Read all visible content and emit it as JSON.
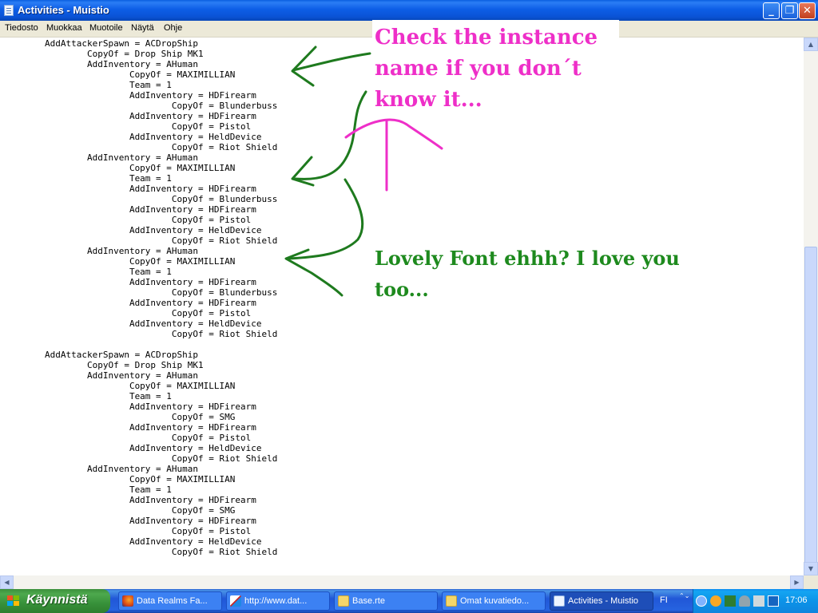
{
  "window": {
    "title": "Activities - Muistio",
    "min_glyph": "_",
    "max_glyph": "❐",
    "close_glyph": "✕"
  },
  "menu": [
    "Tiedosto",
    "Muokkaa",
    "Muotoile",
    "Näytä",
    "Ohje"
  ],
  "editor": {
    "lines": [
      "        AddAttackerSpawn = ACDropShip",
      "                CopyOf = Drop Ship MK1",
      "                AddInventory = AHuman",
      "                        CopyOf = MAXIMILLIAN",
      "                        Team = 1",
      "                        AddInventory = HDFirearm",
      "                                CopyOf = Blunderbuss",
      "                        AddInventory = HDFirearm",
      "                                CopyOf = Pistol",
      "                        AddInventory = HeldDevice",
      "                                CopyOf = Riot Shield",
      "                AddInventory = AHuman",
      "                        CopyOf = MAXIMILLIAN",
      "                        Team = 1",
      "                        AddInventory = HDFirearm",
      "                                CopyOf = Blunderbuss",
      "                        AddInventory = HDFirearm",
      "                                CopyOf = Pistol",
      "                        AddInventory = HeldDevice",
      "                                CopyOf = Riot Shield",
      "                AddInventory = AHuman",
      "                        CopyOf = MAXIMILLIAN",
      "                        Team = 1",
      "                        AddInventory = HDFirearm",
      "                                CopyOf = Blunderbuss",
      "                        AddInventory = HDFirearm",
      "                                CopyOf = Pistol",
      "                        AddInventory = HeldDevice",
      "                                CopyOf = Riot Shield",
      "",
      "        AddAttackerSpawn = ACDropShip",
      "                CopyOf = Drop Ship MK1",
      "                AddInventory = AHuman",
      "                        CopyOf = MAXIMILLIAN",
      "                        Team = 1",
      "                        AddInventory = HDFirearm",
      "                                CopyOf = SMG",
      "                        AddInventory = HDFirearm",
      "                                CopyOf = Pistol",
      "                        AddInventory = HeldDevice",
      "                                CopyOf = Riot Shield",
      "                AddInventory = AHuman",
      "                        CopyOf = MAXIMILLIAN",
      "                        Team = 1",
      "                        AddInventory = HDFirearm",
      "                                CopyOf = SMG",
      "                        AddInventory = HDFirearm",
      "                                CopyOf = Pistol",
      "                        AddInventory = HeldDevice",
      "                                CopyOf = Riot Shield"
    ]
  },
  "annotations": {
    "note1": "Check the instance name if you don´t know it...",
    "note2": "Lovely Font ehhh? I love you too...",
    "note1_color": "#ee2fc8",
    "note2_color": "#1e8a1e"
  },
  "scrollbar": {
    "up_glyph": "▲",
    "down_glyph": "▼",
    "left_glyph": "◀",
    "right_glyph": "▶"
  },
  "taskbar": {
    "start_label": "Käynnistä",
    "buttons": [
      {
        "label": "Data Realms Fa...",
        "icon": "firefox-icon",
        "active": false
      },
      {
        "label": "http://www.dat...",
        "icon": "image-editor-icon",
        "active": false
      },
      {
        "label": "Base.rte",
        "icon": "folder-icon",
        "active": false
      },
      {
        "label": "Omat kuvatiedo...",
        "icon": "pictures-folder-icon",
        "active": false
      },
      {
        "label": "Activities - Muistio",
        "icon": "notepad-icon",
        "active": true
      }
    ],
    "language": "FI",
    "language_arrows": "⌃⌄",
    "clock": "17:06"
  },
  "colors": {
    "title_bar": "#0a5fe0",
    "taskbar": "#245edb",
    "start_button": "#3c8f3c",
    "tray": "#0f8bf0",
    "arrow_green": "#1e7a1e",
    "arrow_magenta": "#ee2fc8"
  }
}
